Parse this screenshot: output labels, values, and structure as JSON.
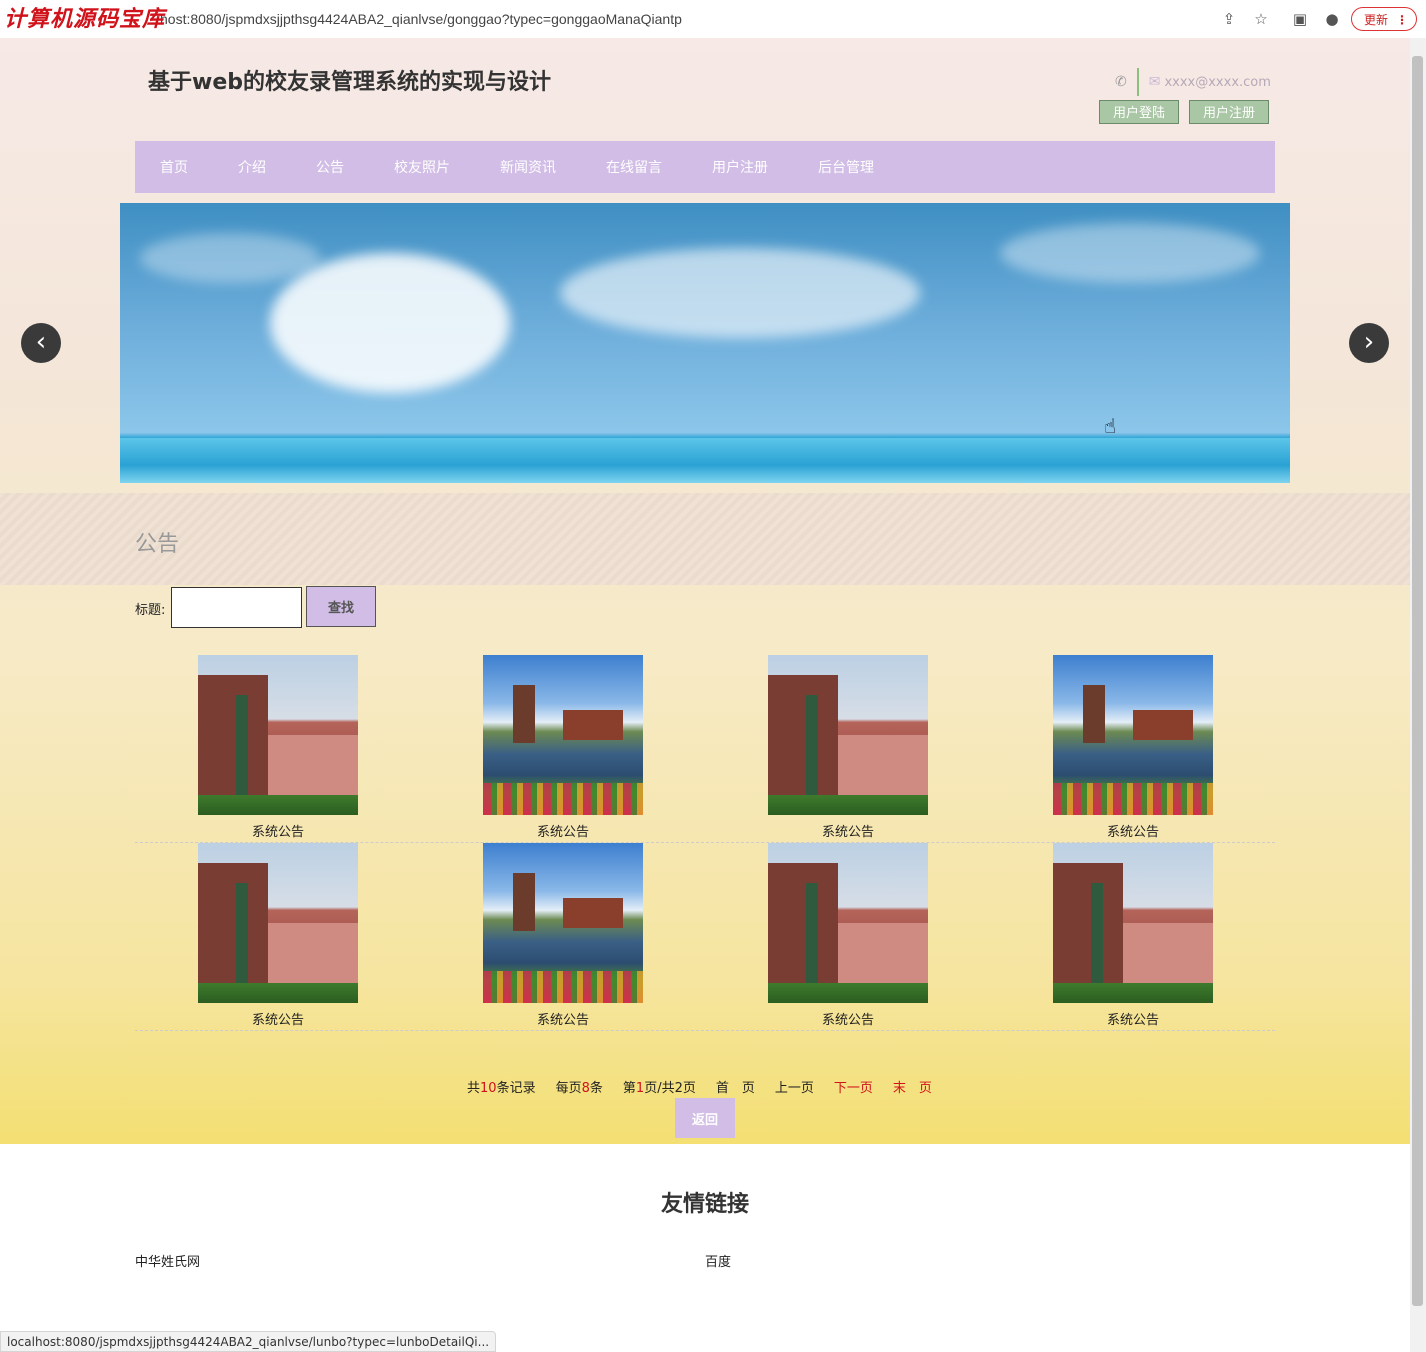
{
  "browser": {
    "watermark": "计算机源码宝库",
    "url": "host:8080/jspmdxsjjpthsg4424ABA2_qianlvse/gonggao?typec=gonggaoManaQiantp",
    "update_label": "更新",
    "status_url": "localhost:8080/jspmdxsjjpthsg4424ABA2_qianlvse/lunbo?typec=lunboDetailQi..."
  },
  "header": {
    "site_title": "基于web的校友录管理系统的实现与设计",
    "email": "xxxx@xxxx.com",
    "login_label": "用户登陆",
    "register_label": "用户注册"
  },
  "nav": {
    "items": [
      {
        "label": "首页"
      },
      {
        "label": "介绍"
      },
      {
        "label": "公告"
      },
      {
        "label": "校友照片"
      },
      {
        "label": "新闻资讯"
      },
      {
        "label": "在线留言"
      },
      {
        "label": "用户注册"
      },
      {
        "label": "后台管理"
      }
    ]
  },
  "section": {
    "title": "公告"
  },
  "search": {
    "label": "标题:",
    "value": "",
    "button": "查找"
  },
  "cards": [
    {
      "caption": "系统公告",
      "image": "building"
    },
    {
      "caption": "系统公告",
      "image": "windmill"
    },
    {
      "caption": "系统公告",
      "image": "building"
    },
    {
      "caption": "系统公告",
      "image": "windmill"
    },
    {
      "caption": "系统公告",
      "image": "building"
    },
    {
      "caption": "系统公告",
      "image": "windmill"
    },
    {
      "caption": "系统公告",
      "image": "building"
    },
    {
      "caption": "系统公告",
      "image": "building"
    }
  ],
  "pager": {
    "total_pre": "共",
    "total_count": "10",
    "total_post": "条记录",
    "per_pre": "每页",
    "per_count": "8",
    "per_post": "条",
    "page_pre": "第",
    "page_current": "1",
    "page_post": "页/共2页",
    "first": "首　页",
    "prev": "上一页",
    "next": "下一页",
    "last": "末　页"
  },
  "back_label": "返回",
  "friend_links": {
    "title": "友情链接",
    "items": [
      {
        "label": "中华姓氏网"
      },
      {
        "label": "百度"
      }
    ]
  }
}
